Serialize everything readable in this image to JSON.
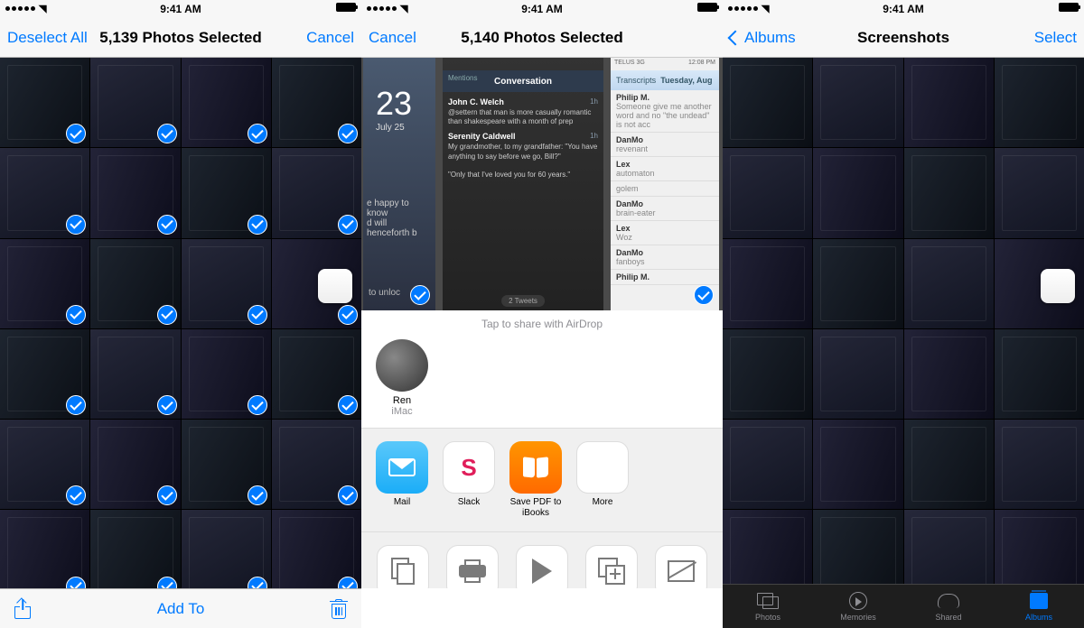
{
  "status": {
    "time": "9:41 AM"
  },
  "screen1": {
    "deselect": "Deselect All",
    "title": "5,139 Photos Selected",
    "cancel": "Cancel",
    "addTo": "Add To"
  },
  "screen2": {
    "cancel": "Cancel",
    "title": "5,140 Photos Selected",
    "airdrop": "Tap to share with AirDrop",
    "contact": {
      "name": "Ren",
      "device": "iMac"
    },
    "apps": [
      {
        "label": "Mail"
      },
      {
        "label": "Slack"
      },
      {
        "label": "Save PDF to iBooks"
      },
      {
        "label": "More"
      }
    ],
    "actions": [
      {
        "label": "Copy"
      },
      {
        "label": "Print"
      },
      {
        "label": "Slideshow"
      },
      {
        "label": "Duplicate"
      },
      {
        "label": "Hide"
      }
    ],
    "preview1": {
      "bignum": "23",
      "date": "July 25",
      "know": "e happy to know\nd will henceforth b",
      "unlock": "to unloc"
    },
    "preview2": {
      "header": "Conversation",
      "mentions": "Mentions",
      "tweetsPill": "2 Tweets",
      "msg1_who": "John C. Welch",
      "msg1_body": "@settern that man is more casually romantic than shakespeare with a month of prep",
      "msg2_who": "Serenity Caldwell",
      "msg2_body": "My grandmother, to my grandfather: \"You have anything to say before we go, Bill?\"",
      "msg2_quote": "\"Only that I've loved you for 60 years.\""
    },
    "preview3": {
      "carrier": "TELUS 3G",
      "time": "12:08 PM",
      "transcripts": "Transcripts",
      "day": "Tuesday, Aug",
      "entries": [
        {
          "n": "Philip M.",
          "s": "Someone give me another word and no \"the undead\" is not acc"
        },
        {
          "n": "DanMo",
          "s": "revenant"
        },
        {
          "n": "Lex",
          "s": "automaton"
        },
        {
          "n": "",
          "s": "golem"
        },
        {
          "n": "DanMo",
          "s": "brain-eater"
        },
        {
          "n": "Lex",
          "s": "Woz"
        },
        {
          "n": "DanMo",
          "s": "fanboys"
        },
        {
          "n": "Philip M.",
          "s": ""
        }
      ]
    }
  },
  "screen3": {
    "back": "Albums",
    "title": "Screenshots",
    "select": "Select",
    "tabs": [
      {
        "label": "Photos"
      },
      {
        "label": "Memories"
      },
      {
        "label": "Shared"
      },
      {
        "label": "Albums"
      }
    ]
  }
}
